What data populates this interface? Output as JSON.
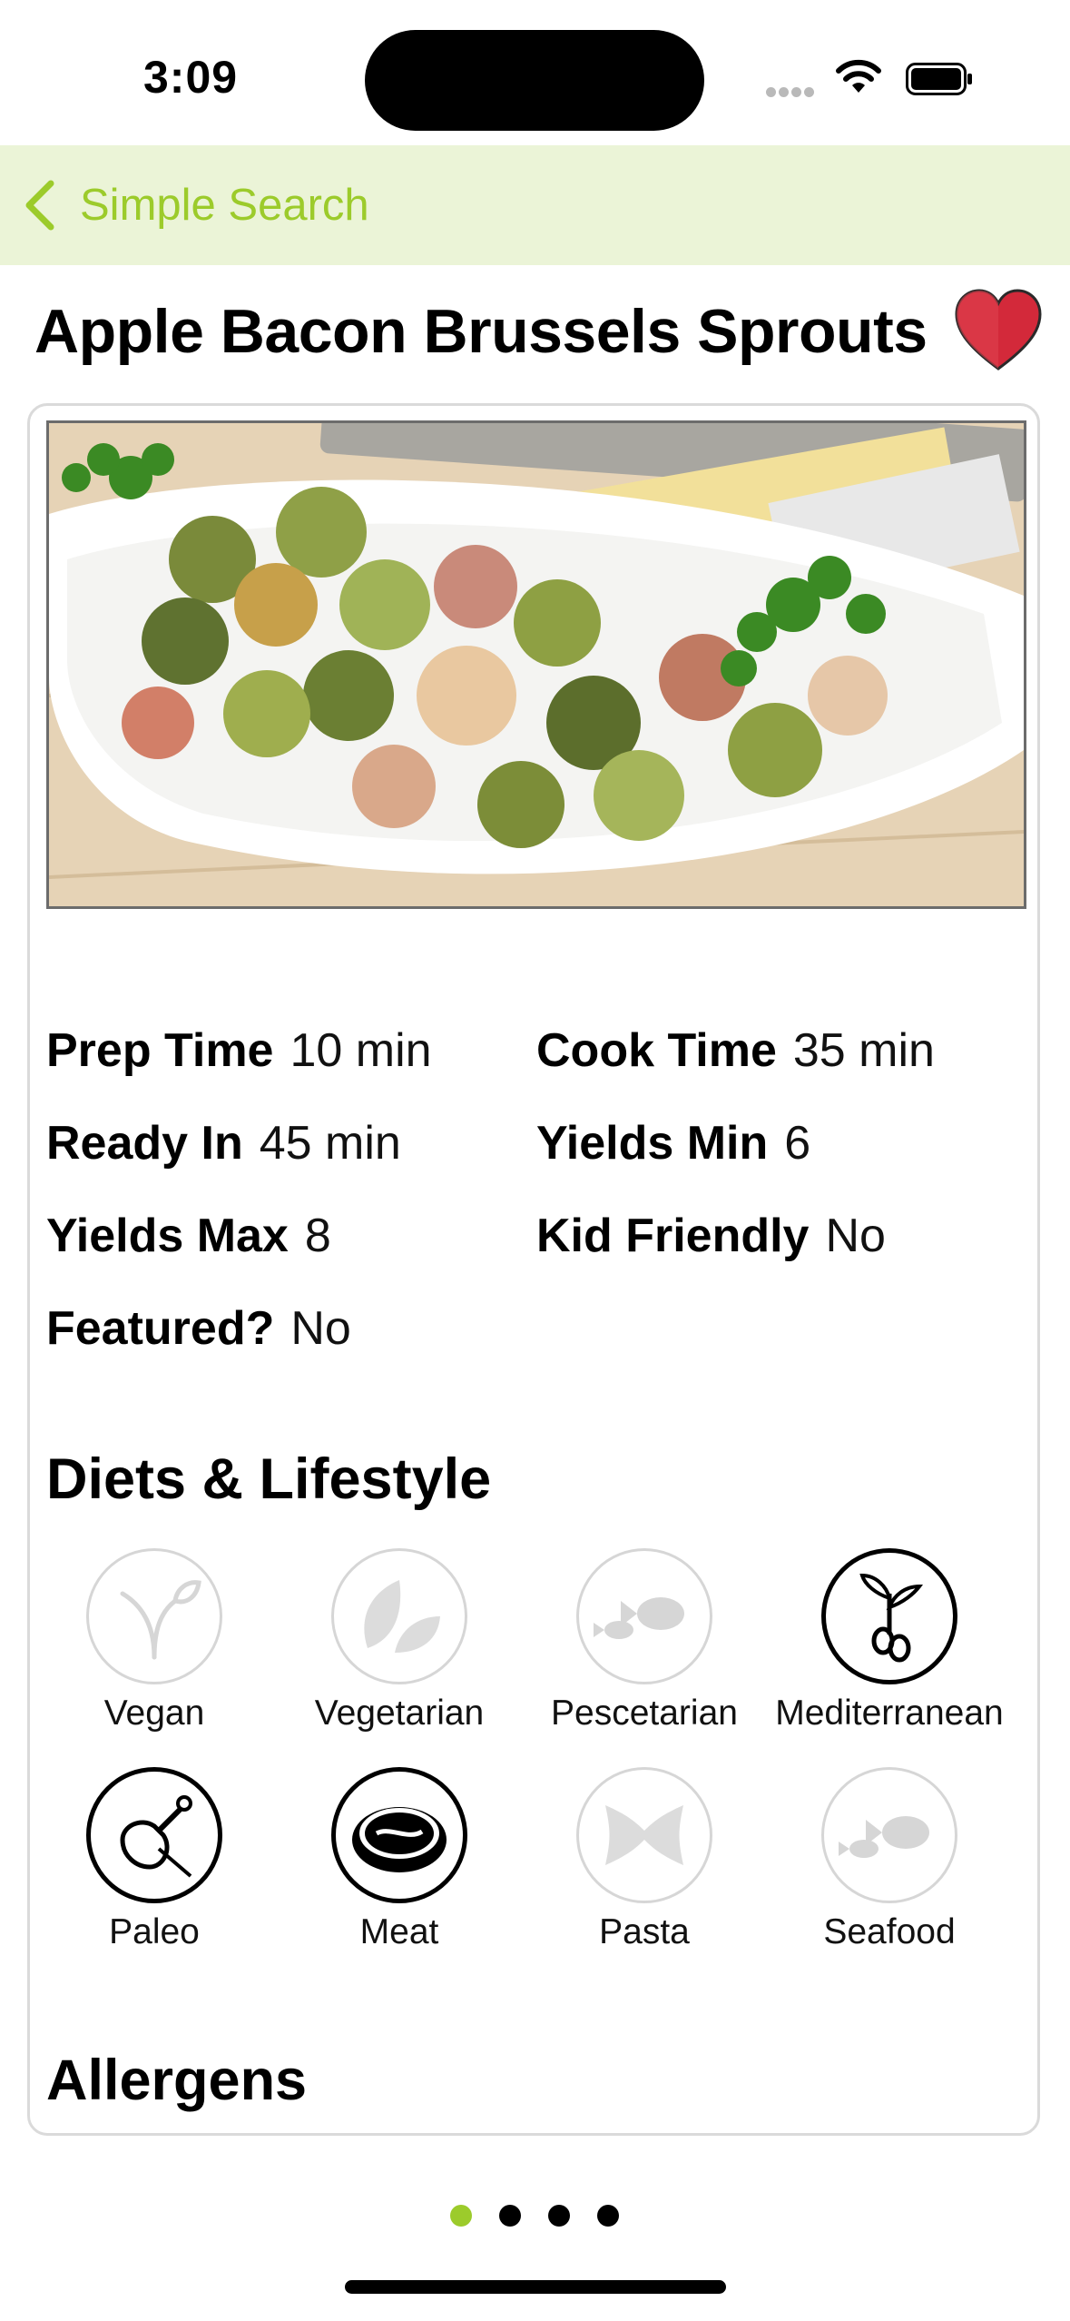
{
  "status_bar": {
    "time": "3:09"
  },
  "nav": {
    "back_label": "Simple Search"
  },
  "recipe": {
    "title": "Apple Bacon Brussels Sprouts"
  },
  "stats": [
    {
      "key": "Prep Time",
      "value": "10 min"
    },
    {
      "key": "Cook Time",
      "value": "35 min"
    },
    {
      "key": "Ready In",
      "value": "45 min"
    },
    {
      "key": "Yields Min",
      "value": "6"
    },
    {
      "key": "Yields Max",
      "value": "8"
    },
    {
      "key": "Kid Friendly",
      "value": "No"
    },
    {
      "key": "Featured?",
      "value": "No"
    }
  ],
  "sections": {
    "diets": "Diets & Lifestyle",
    "allergens": "Allergens"
  },
  "diets": [
    {
      "label": "Vegan",
      "icon": "sprout-icon",
      "active": false
    },
    {
      "label": "Vegetarian",
      "icon": "leaves-icon",
      "active": false
    },
    {
      "label": "Pescetarian",
      "icon": "fish-icon",
      "active": false
    },
    {
      "label": "Mediterranean",
      "icon": "olive-branch-icon",
      "active": true
    },
    {
      "label": "Paleo",
      "icon": "meat-leg-icon",
      "active": true
    },
    {
      "label": "Meat",
      "icon": "steak-icon",
      "active": true
    },
    {
      "label": "Pasta",
      "icon": "pasta-bow-icon",
      "active": false
    },
    {
      "label": "Seafood",
      "icon": "fish-icon",
      "active": false
    }
  ],
  "colors": {
    "accent": "#9ccb2b",
    "nav_background": "#ebf4d7",
    "heart": "#d3293a",
    "inactive_icon": "#d6d6d6"
  },
  "page_control": {
    "pages": 4,
    "current": 1
  }
}
